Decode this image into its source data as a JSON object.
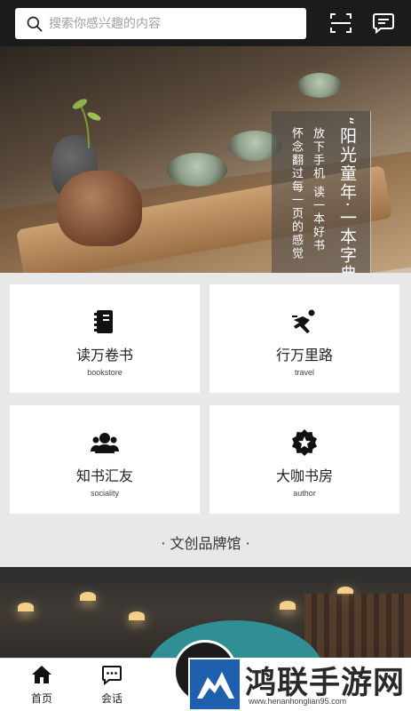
{
  "search": {
    "placeholder": "搜索你感兴趣的内容"
  },
  "icons": {
    "search": "search-icon",
    "scan": "scan-icon",
    "message": "message-icon"
  },
  "hero": {
    "title": "“阳光童年·一本字典”",
    "line1": "放下手机 读一本好书",
    "line2": "怀念翻过每一页的感觉"
  },
  "cards": [
    {
      "title": "读万卷书",
      "subtitle": "bookstore",
      "icon": "book-icon"
    },
    {
      "title": "行万里路",
      "subtitle": "travel",
      "icon": "runner-icon"
    },
    {
      "title": "知书汇友",
      "subtitle": "sociality",
      "icon": "group-icon"
    },
    {
      "title": "大咖书房",
      "subtitle": "author",
      "icon": "star-badge-icon"
    }
  ],
  "section": {
    "title": "· 文创品牌馆 ·"
  },
  "tabbar": [
    {
      "label": "首页",
      "icon": "home-icon"
    },
    {
      "label": "会话",
      "icon": "chat-icon"
    }
  ],
  "watermark": {
    "name": "鸿联手游网",
    "url": "www.henanhonglian95.com"
  },
  "colors": {
    "topbar": "#1b1b1b",
    "background": "#e8e8e8",
    "card": "#ffffff"
  }
}
